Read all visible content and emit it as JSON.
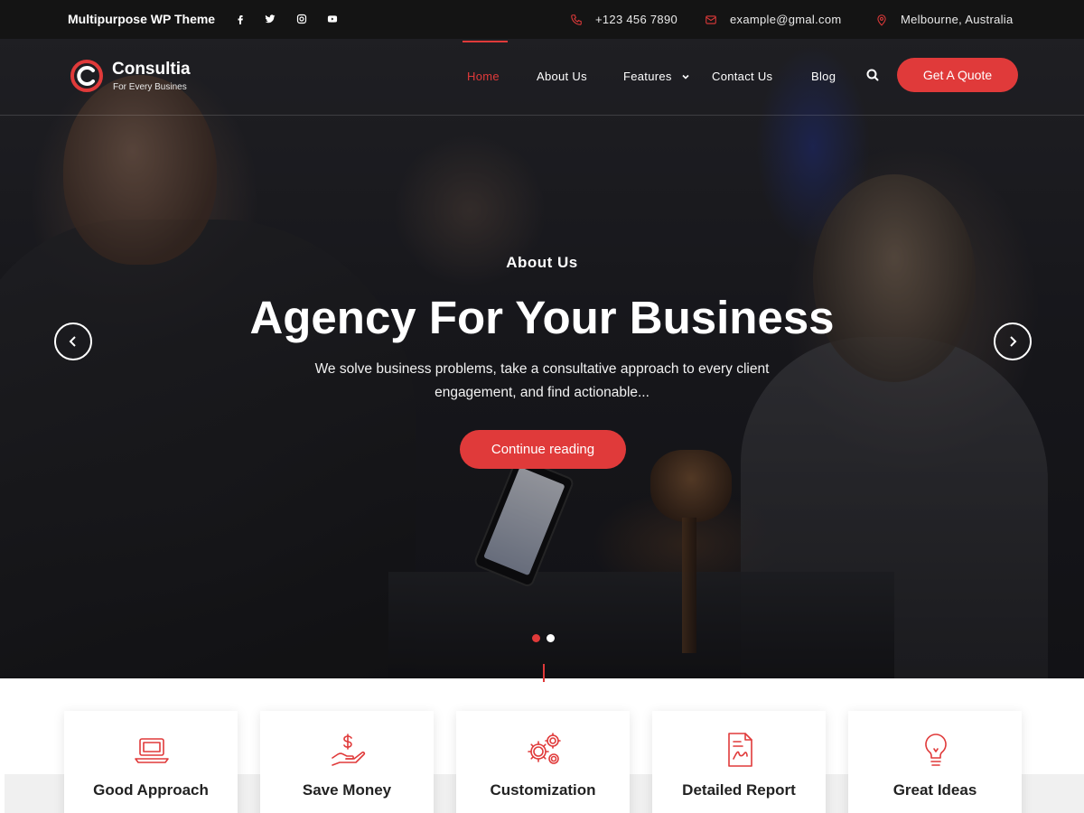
{
  "topbar": {
    "tagline": "Multipurpose WP Theme",
    "social": [
      "facebook-icon",
      "twitter-icon",
      "instagram-icon",
      "youtube-icon"
    ],
    "phone": "+123 456 7890",
    "email": "example@gmal.com",
    "location": "Melbourne, Australia"
  },
  "brand": {
    "name": "Consultia",
    "tagline": "For Every Busines",
    "accent": "#e03a3a"
  },
  "nav": {
    "items": [
      {
        "label": "Home",
        "active": true
      },
      {
        "label": "About Us"
      },
      {
        "label": "Features",
        "has_dropdown": true
      },
      {
        "label": "Contact Us"
      },
      {
        "label": "Blog"
      }
    ],
    "cta": "Get A Quote"
  },
  "hero": {
    "eyebrow": "About Us",
    "title": "Agency For Your Business",
    "description": "We solve business problems, take a consultative approach to every client engagement, and find actionable...",
    "button": "Continue reading",
    "slides": 2,
    "active_slide": 1
  },
  "features": [
    {
      "title": "Good Approach",
      "icon": "laptop-icon"
    },
    {
      "title": "Save Money",
      "icon": "money-hand-icon"
    },
    {
      "title": "Customization",
      "icon": "gears-icon"
    },
    {
      "title": "Detailed Report",
      "icon": "report-icon"
    },
    {
      "title": "Great Ideas",
      "icon": "lightbulb-icon"
    }
  ]
}
